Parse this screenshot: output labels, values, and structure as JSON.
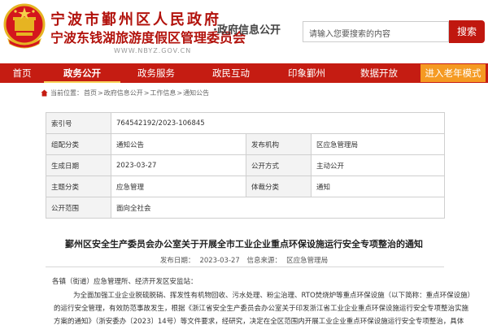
{
  "header": {
    "title_line1": "宁波市鄞州区人民政府",
    "title_line2": "宁波东钱湖旅游度假区管理委员会",
    "subtitle": "·政府信息公开",
    "url": "WWW.NBYZ.GOV.CN",
    "search_placeholder": "请输入您要搜索的内容",
    "search_button": "搜索"
  },
  "nav": {
    "items": [
      {
        "label": "首页"
      },
      {
        "label": "政务公开"
      },
      {
        "label": "政务服务"
      },
      {
        "label": "政民互动"
      },
      {
        "label": "印象鄞州"
      },
      {
        "label": "数据开放"
      }
    ],
    "active_index": 1,
    "elder_mode": "进入老年模式"
  },
  "breadcrumb": {
    "prefix": "当前位置：",
    "items": [
      "首页",
      "政府信息公开",
      "工作信息",
      "通知公告"
    ],
    "separator": ">"
  },
  "info_table": {
    "index_label": "索引号",
    "index_value": "764542192/2023-106845",
    "category_label": "组配分类",
    "category_value": "通知公告",
    "publisher_label": "发布机构",
    "publisher_value": "区应急管理局",
    "date_label": "生成日期",
    "date_value": "2023-03-27",
    "disclosure_label": "公开方式",
    "disclosure_value": "主动公开",
    "topic_label": "主题分类",
    "topic_value": "应急管理",
    "genre_label": "体裁分类",
    "genre_value": "通知",
    "scope_label": "公开范围",
    "scope_value": "面向全社会"
  },
  "article": {
    "title": "鄞州区安全生产委员会办公室关于开展全市工业企业重点环保设施运行安全专项整治的通知",
    "meta_date_label": "发布日期：",
    "meta_date": "2023-03-27",
    "meta_source_label": "信息来源：",
    "meta_source": "区应急管理局",
    "salutation": "各镇（街道）应急管理所、经济开发区安监站：",
    "para1": "为全面加强工业企业脱硫脱硝、挥发性有机物回收、污水处理、粉尘治理、RTO焚烧炉等重点环保设施（以下简称：重点环保设施）",
    "para2": "的运行安全管理，有效防范事故发生，根据《浙江省安全生产委员会办公室关于印发浙江省工业企业重点环保设施运行安全专项整治实施",
    "para3": "方案的通知》（浙安委办〔2023〕14号）等文件要求，经研究，决定在全区范围内开展工业企业重点环保设施运行安全专项整治，具体"
  },
  "colors": {
    "brand_red": "#c51c12",
    "elder_orange": "#f59a22",
    "active_underline": "#f7d25a"
  }
}
